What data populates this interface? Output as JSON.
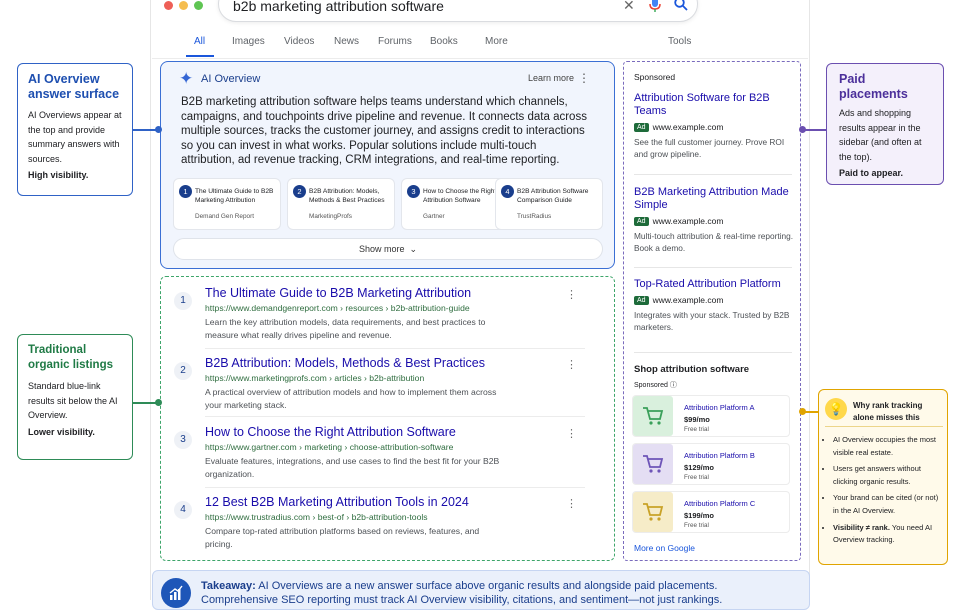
{
  "search": {
    "query": "b2b marketing attribution software"
  },
  "tabs": [
    {
      "label": "All",
      "active": true
    },
    {
      "label": "Images"
    },
    {
      "label": "Videos"
    },
    {
      "label": "News"
    },
    {
      "label": "Forums"
    },
    {
      "label": "Books"
    },
    {
      "label": "More"
    },
    {
      "label": "Tools"
    }
  ],
  "ai_overview": {
    "title": "AI Overview",
    "learn_more": "Learn more",
    "text": "B2B marketing attribution software helps teams understand which channels, campaigns, and touchpoints drive pipeline and revenue. It connects data across multiple sources, tracks the customer journey, and assigns credit to interactions so you can invest in what works. Popular solutions include multi-touch attribution, ad revenue tracking, CRM integrations, and real-time reporting.",
    "sources": [
      {
        "num": "1",
        "title": "The Ultimate Guide to B2B Marketing Attribution",
        "publisher": "Demand Gen Report"
      },
      {
        "num": "2",
        "title": "B2B Attribution: Models, Methods & Best Practices",
        "publisher": "MarketingProfs"
      },
      {
        "num": "3",
        "title": "How to Choose the Right Attribution Software",
        "publisher": "Gartner"
      },
      {
        "num": "4",
        "title": "B2B Attribution Software Comparison Guide",
        "publisher": "TrustRadius"
      }
    ],
    "show_more": "Show more"
  },
  "organic": [
    {
      "num": "1",
      "title": "The Ultimate Guide to B2B Marketing Attribution",
      "url": "https://www.demandgenreport.com › resources › b2b-attribution-guide",
      "desc": "Learn the key attribution models, data requirements, and best practices to measure what really drives pipeline and revenue."
    },
    {
      "num": "2",
      "title": "B2B Attribution: Models, Methods & Best Practices",
      "url": "https://www.marketingprofs.com › articles › b2b-attribution",
      "desc": "A practical overview of attribution models and how to implement them across your marketing stack."
    },
    {
      "num": "3",
      "title": "How to Choose the Right Attribution Software",
      "url": "https://www.gartner.com › marketing › choose-attribution-software",
      "desc": "Evaluate features, integrations, and use cases to find the best fit for your B2B organization."
    },
    {
      "num": "4",
      "title": "12 Best B2B Marketing Attribution Tools in 2024",
      "url": "https://www.trustradius.com › best-of › b2b-attribution-tools",
      "desc": "Compare top-rated attribution platforms based on reviews, features, and pricing."
    }
  ],
  "sidebar": {
    "sponsored": "Sponsored",
    "ad_tag": "Ad",
    "ads": [
      {
        "title": "Attribution Software for B2B Teams",
        "domain": "www.example.com",
        "desc": "See the full customer journey. Prove ROI and grow pipeline."
      },
      {
        "title": "B2B Marketing Attribution Made Simple",
        "domain": "www.example.com",
        "desc": "Multi-touch attribution & real-time reporting. Book a demo."
      },
      {
        "title": "Top-Rated Attribution Platform",
        "domain": "www.example.com",
        "desc": "Integrates with your stack. Trusted by B2B marketers."
      }
    ],
    "shop_title": "Shop attribution software",
    "shop_sponsored": "Sponsored",
    "products": [
      {
        "name": "Attribution Platform A",
        "price": "$99/mo",
        "trial": "Free trial",
        "color": "#d9f0dd",
        "icon_color": "#3aa05a"
      },
      {
        "name": "Attribution Platform B",
        "price": "$129/mo",
        "trial": "Free trial",
        "color": "#e4def3",
        "icon_color": "#6e55b8"
      },
      {
        "name": "Attribution Platform C",
        "price": "$199/mo",
        "trial": "Free trial",
        "color": "#f6ecc8",
        "icon_color": "#c9a227"
      }
    ],
    "more_google": "More on Google"
  },
  "callouts": {
    "ai": {
      "title": "AI Overview answer surface",
      "body": "AI Overviews appear at the top and provide summary answers with sources.",
      "strong": "High visibility.",
      "color": "#2f62c6"
    },
    "organic": {
      "title": "Traditional organic listings",
      "body": "Standard blue-link results sit below the AI Overview.",
      "strong": "Lower visibility.",
      "color": "#2e8b57"
    },
    "paid": {
      "title": "Paid placements",
      "body": "Ads and shopping results appear in the sidebar (and often at the top).",
      "strong": "Paid to appear.",
      "color": "#6b4fb0"
    },
    "rank": {
      "title": "Why rank tracking alone misses this",
      "bullets": [
        "AI Overview occupies the most visible real estate.",
        "Users get answers without clicking organic results.",
        "Your brand can be cited (or not) in the AI Overview."
      ],
      "last_strong": "Visibility ≠ rank.",
      "last_rest": "You need AI Overview tracking.",
      "color": "#e0a400"
    }
  },
  "takeaway": {
    "label": "Takeaway:",
    "text": "AI Overviews are a new answer surface above organic results and alongside paid placements.",
    "text2": "Comprehensive SEO reporting must track AI Overview visibility, citations, and sentiment—not just rankings."
  }
}
